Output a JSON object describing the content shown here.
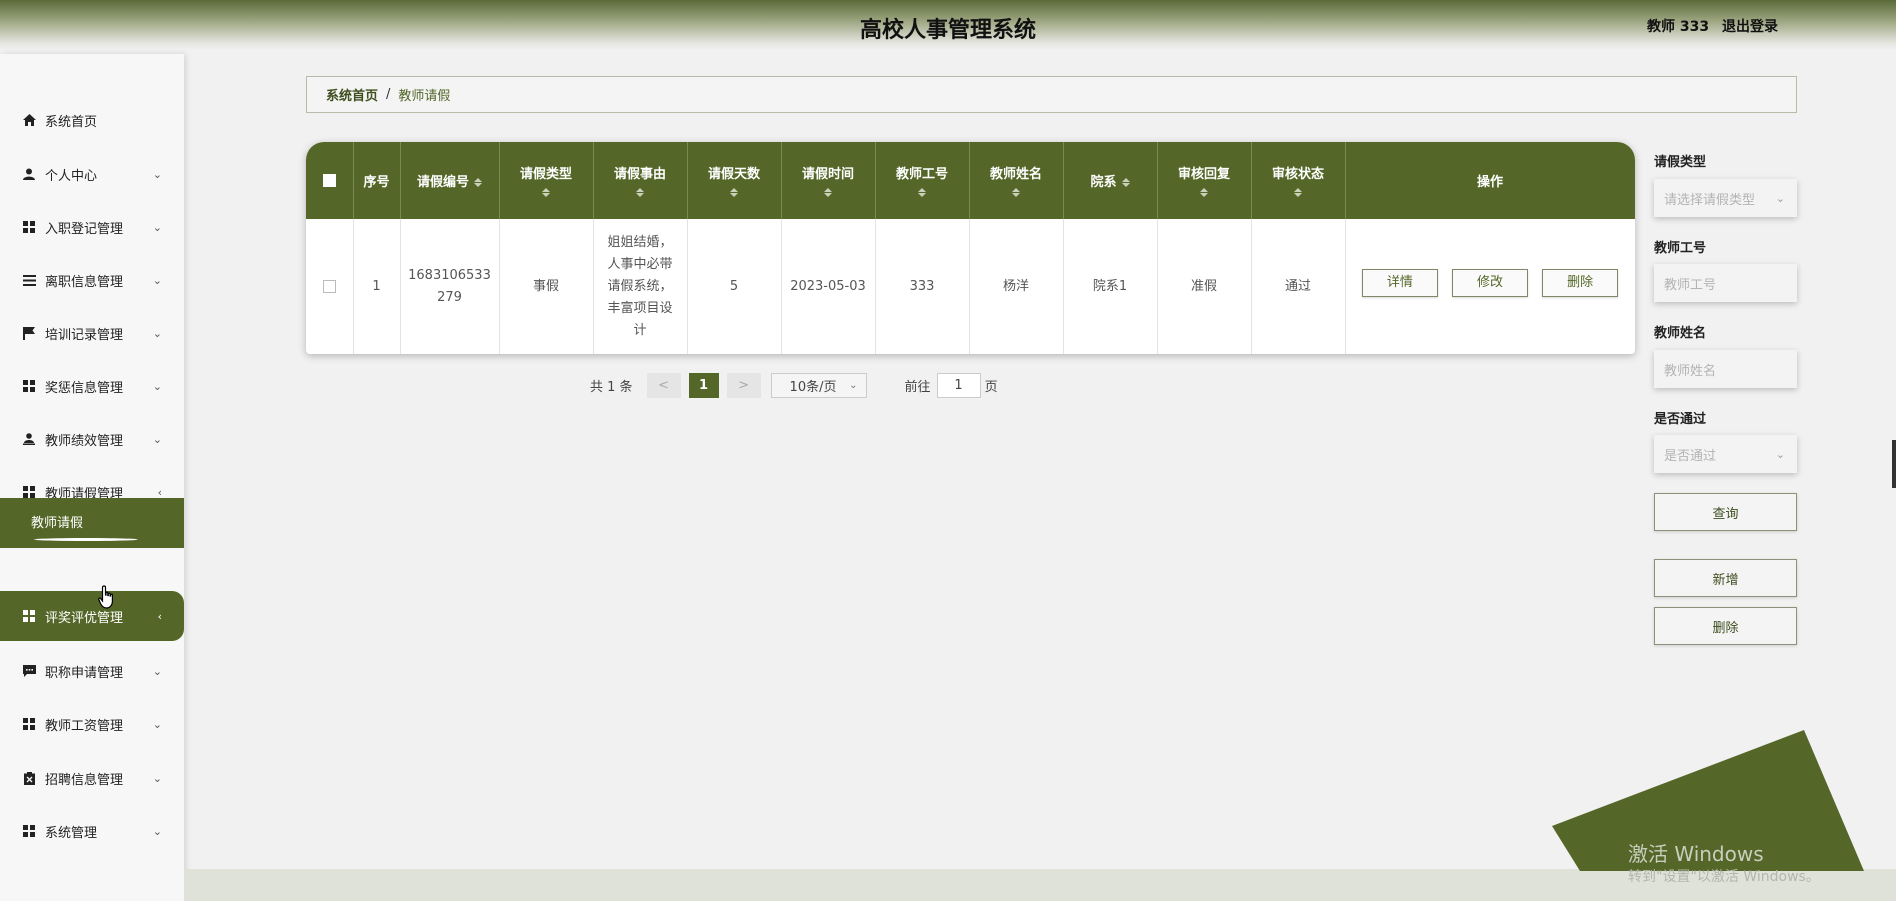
{
  "header": {
    "title": "高校人事管理系统",
    "user": "教师 333",
    "logout": "退出登录"
  },
  "sidebar": {
    "items": [
      {
        "label": "系统首页",
        "icon": "home-icon"
      },
      {
        "label": "个人中心",
        "icon": "user-icon",
        "arrow": "⌄"
      },
      {
        "label": "入职登记管理",
        "icon": "grid-icon",
        "arrow": "⌄"
      },
      {
        "label": "离职信息管理",
        "icon": "list-icon",
        "arrow": "⌄"
      },
      {
        "label": "培训记录管理",
        "icon": "flag-icon",
        "arrow": "⌄"
      },
      {
        "label": "奖惩信息管理",
        "icon": "grid-icon",
        "arrow": "⌄"
      },
      {
        "label": "教师绩效管理",
        "icon": "person-icon",
        "arrow": "⌄"
      },
      {
        "label": "教师请假管理",
        "icon": "grid-icon",
        "arrow": "‹"
      },
      {
        "label": "评奖评优管理",
        "icon": "grid-icon",
        "arrow": "‹"
      },
      {
        "label": "职称申请管理",
        "icon": "chat-icon",
        "arrow": "⌄"
      },
      {
        "label": "教师工资管理",
        "icon": "grid-icon",
        "arrow": "⌄"
      },
      {
        "label": "招聘信息管理",
        "icon": "clipboard-icon",
        "arrow": "⌄"
      },
      {
        "label": "系统管理",
        "icon": "grid-icon",
        "arrow": "⌄"
      }
    ],
    "active_sub": "教师请假"
  },
  "breadcrumb": {
    "home": "系统首页",
    "sep": "/",
    "current": "教师请假"
  },
  "table": {
    "headers": [
      "序号",
      "请假编号",
      "请假类型",
      "请假事由",
      "请假天数",
      "请假时间",
      "教师工号",
      "教师姓名",
      "院系",
      "审核回复",
      "审核状态",
      "操作"
    ],
    "rows": [
      {
        "index": "1",
        "code": "1683106533279",
        "type": "事假",
        "reason": "姐姐结婚，人事中必带请假系统，丰富项目设计",
        "days": "5",
        "date": "2023-05-03",
        "teacher_id": "333",
        "teacher_name": "杨洋",
        "department": "院系1",
        "reply": "准假",
        "status": "通过"
      }
    ],
    "actions": {
      "detail": "详情",
      "edit": "修改",
      "delete": "删除"
    }
  },
  "pagination": {
    "total": "共 1 条",
    "prev": "<",
    "page": "1",
    "next": ">",
    "page_size": "10条/页",
    "goto": "前往",
    "goto_value": "1",
    "unit": "页"
  },
  "filters": {
    "leave_type_label": "请假类型",
    "leave_type_placeholder": "请选择请假类型",
    "teacher_id_label": "教师工号",
    "teacher_id_placeholder": "教师工号",
    "teacher_name_label": "教师姓名",
    "teacher_name_placeholder": "教师姓名",
    "passed_label": "是否通过",
    "passed_placeholder": "是否通过",
    "search": "查询",
    "add": "新增",
    "delete": "删除"
  },
  "watermark": {
    "title": "激活 Windows",
    "sub": "转到\"设置\"以激活 Windows。"
  },
  "colors": {
    "accent": "#546728",
    "background": "#f1f1f1"
  }
}
